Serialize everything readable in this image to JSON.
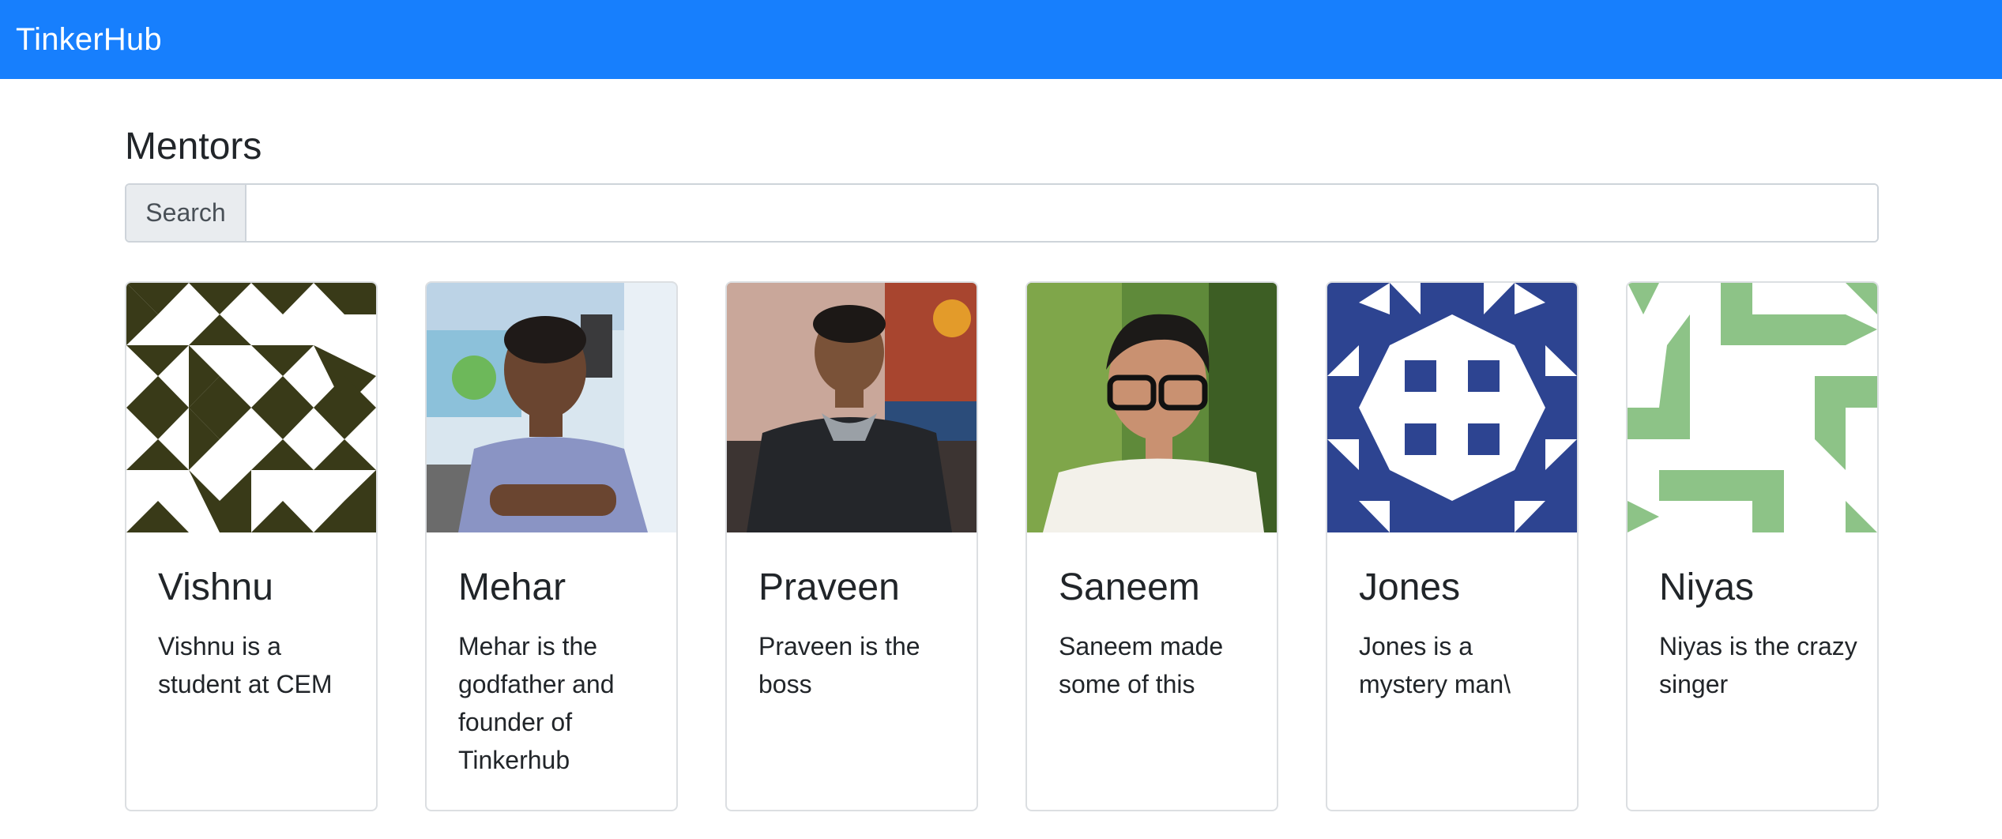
{
  "navbar": {
    "brand": "TinkerHub"
  },
  "page": {
    "title": "Mentors"
  },
  "search": {
    "label": "Search",
    "value": "",
    "placeholder": ""
  },
  "mentors": [
    {
      "name": "Vishnu",
      "bio": "Vishnu is a student at CEM",
      "avatar": "identicon",
      "color": "#393a18"
    },
    {
      "name": "Mehar",
      "bio": "Mehar is the godfather and founder of Tinkerhub",
      "avatar": "photo",
      "color": "#8a94c4"
    },
    {
      "name": "Praveen",
      "bio": "Praveen is the boss",
      "avatar": "photo",
      "color": "#2a2b2d"
    },
    {
      "name": "Saneem",
      "bio": "Saneem made some of this",
      "avatar": "photo",
      "color": "#4e7a30"
    },
    {
      "name": "Jones",
      "bio": "Jones is a mystery man\\",
      "avatar": "identicon",
      "color": "#2d4491"
    },
    {
      "name": "Niyas",
      "bio": "Niyas is the crazy singer",
      "avatar": "identicon",
      "color": "#8dc387"
    }
  ]
}
